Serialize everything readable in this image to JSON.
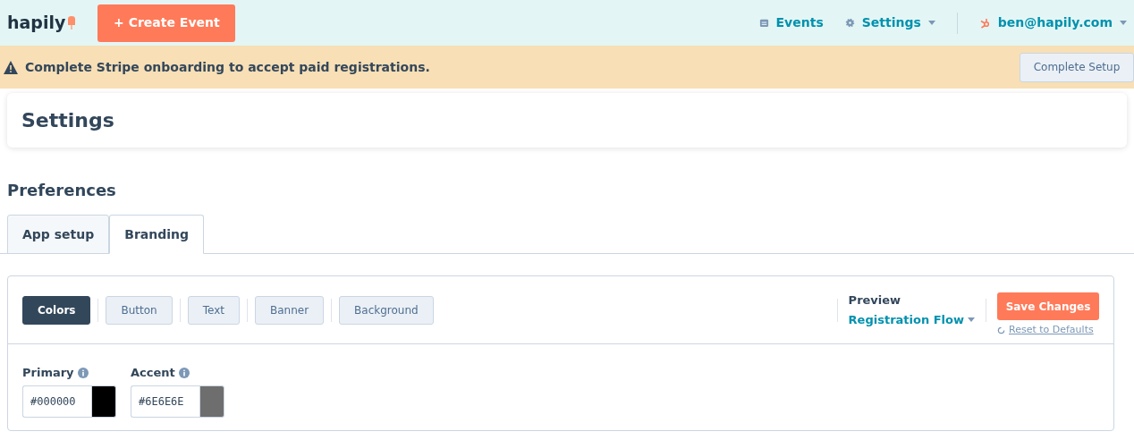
{
  "header": {
    "logo": "hapily",
    "create_button": "+ Create Event",
    "nav": [
      {
        "label": "Events",
        "dropdown": false
      },
      {
        "label": "Settings",
        "dropdown": true
      }
    ],
    "user": "ben@hapily.com"
  },
  "alert": {
    "message": "Complete Stripe onboarding to accept paid registrations.",
    "button": "Complete Setup"
  },
  "page_title": "Settings",
  "section_title": "Preferences",
  "tabs": [
    {
      "label": "App setup",
      "selected": false
    },
    {
      "label": "Branding",
      "selected": true
    }
  ],
  "subtabs": [
    {
      "label": "Colors",
      "selected": true
    },
    {
      "label": "Button",
      "selected": false
    },
    {
      "label": "Text",
      "selected": false
    },
    {
      "label": "Banner",
      "selected": false
    },
    {
      "label": "Background",
      "selected": false
    }
  ],
  "preview": {
    "label": "Preview",
    "value": "Registration Flow"
  },
  "save_button": "Save Changes",
  "reset_link": "Reset to Defaults",
  "colors": [
    {
      "label": "Primary",
      "value": "#000000",
      "color": "#000000"
    },
    {
      "label": "Accent",
      "value": "#6E6E6E",
      "color": "#6e6e6e"
    }
  ]
}
